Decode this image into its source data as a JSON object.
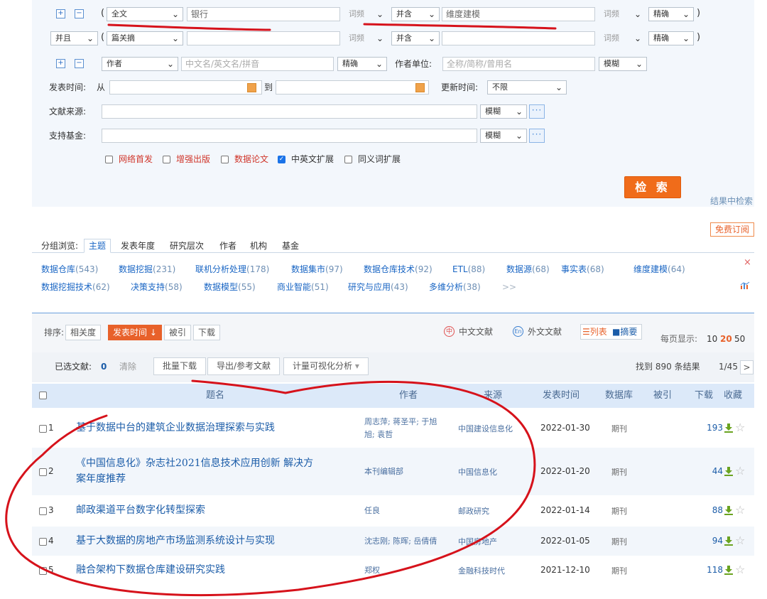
{
  "search": {
    "row1": {
      "plus": "+",
      "minus": "−",
      "open_paren": "(",
      "field": "全文",
      "value": "银行",
      "freq": "词频",
      "logic": "并含",
      "value2": "维度建模",
      "freq2": "词频",
      "match": "精确",
      "close_paren": ")"
    },
    "row2": {
      "op": "并且",
      "open_paren": "(",
      "field": "篇关摘",
      "value": "",
      "freq": "词频",
      "logic": "并含",
      "value2": "",
      "freq2": "词频",
      "match": "精确",
      "close_paren": ")"
    },
    "row3": {
      "plus": "+",
      "minus": "−",
      "field": "作者",
      "placeholder": "中文名/英文名/拼音",
      "match": "精确",
      "unit_label": "作者单位:",
      "unit_placeholder": "全称/简称/曾用名",
      "unit_match": "模糊"
    },
    "date": {
      "label": "发表时间:",
      "from": "从",
      "to": "到",
      "update_label": "更新时间:",
      "update_value": "不限"
    },
    "source": {
      "label": "文献来源:",
      "match": "模糊",
      "more": "···"
    },
    "fund": {
      "label": "支持基金:",
      "match": "模糊",
      "more": "···"
    },
    "options": [
      {
        "label": "网络首发",
        "checked": false,
        "red": true
      },
      {
        "label": "增强出版",
        "checked": false,
        "red": true
      },
      {
        "label": "数据论文",
        "checked": false,
        "red": true
      },
      {
        "label": "中英文扩展",
        "checked": true,
        "red": false
      },
      {
        "label": "同义词扩展",
        "checked": false,
        "red": false
      }
    ],
    "search_button": "检 索",
    "in_results": "结果中检索"
  },
  "subscribe": "免费订阅",
  "group": {
    "label": "分组浏览:",
    "tabs": [
      "主题",
      "发表年度",
      "研究层次",
      "作者",
      "机构",
      "基金"
    ],
    "active_tab": "主题",
    "keywords_row1": [
      {
        "name": "数据仓库",
        "count": "(543)"
      },
      {
        "name": "数据挖掘",
        "count": "(231)"
      },
      {
        "name": "联机分析处理",
        "count": "(178)"
      },
      {
        "name": "数据集市",
        "count": "(97)"
      },
      {
        "name": "数据仓库技术",
        "count": "(92)"
      },
      {
        "name": "ETL",
        "count": "(88)"
      },
      {
        "name": "数据源",
        "count": "(68)"
      },
      {
        "name": "事实表",
        "count": "(68)"
      },
      {
        "name": "维度建模",
        "count": "(64)"
      }
    ],
    "keywords_row2": [
      {
        "name": "数据挖掘技术",
        "count": "(62)"
      },
      {
        "name": "决策支持",
        "count": "(58)"
      },
      {
        "name": "数据模型",
        "count": "(55)"
      },
      {
        "name": "商业智能",
        "count": "(51)"
      },
      {
        "name": "研究与应用",
        "count": "(43)"
      },
      {
        "name": "多维分析",
        "count": "(38)"
      }
    ],
    "more": ">>",
    "close": "×"
  },
  "toolbar": {
    "sort_label": "排序:",
    "sort_options": [
      "相关度",
      "发表时间",
      "被引",
      "下载"
    ],
    "active_sort": "发表时间",
    "zh_docs": "中文文献",
    "foreign_docs": "外文文献",
    "view_list": "列表",
    "view_abstract": "摘要",
    "per_page_label": "每页显示:",
    "per_page": [
      "10",
      "20",
      "50"
    ],
    "active_per_page": "20",
    "selected_label": "已选文献:",
    "selected_count": "0",
    "clear": "清除",
    "batch_download": "批量下载",
    "export": "导出/参考文献",
    "visual_analysis": "计量可视化分析",
    "found_prefix": "找到",
    "found_count": "890",
    "found_suffix": "条结果",
    "page": "1/45",
    "next": ">"
  },
  "table": {
    "headers": [
      "题名",
      "作者",
      "来源",
      "发表时间",
      "数据库",
      "被引",
      "下载",
      "收藏"
    ],
    "rows": [
      {
        "no": "1",
        "title": "基于数据中台的建筑企业数据治理探索与实践",
        "title2": "",
        "author": "周志萍; 蒋圣平; 于旭",
        "author2": "旭; 袁哲",
        "source": "中国建设信息化",
        "date": "2022-01-30",
        "db": "期刊",
        "cited": "",
        "downloads": "193"
      },
      {
        "no": "2",
        "title": "《中国信息化》杂志社2021信息技术应用创新 解决方",
        "title2": "案年度推荐",
        "author": "本刊编辑部",
        "author2": "",
        "source": "中国信息化",
        "date": "2022-01-20",
        "db": "期刊",
        "cited": "",
        "downloads": "44"
      },
      {
        "no": "3",
        "title": "邮政渠道平台数字化转型探索",
        "title2": "",
        "author": "任良",
        "author2": "",
        "source": "邮政研究",
        "date": "2022-01-14",
        "db": "期刊",
        "cited": "",
        "downloads": "88"
      },
      {
        "no": "4",
        "title": "基于大数据的房地产市场监测系统设计与实现",
        "title2": "",
        "author": "沈志刚; 陈晖; 岳倩倩",
        "author2": "",
        "source": "中国房地产",
        "date": "2022-01-05",
        "db": "期刊",
        "cited": "",
        "downloads": "94"
      },
      {
        "no": "5",
        "title": "融合架构下数据仓库建设研究实践",
        "title2": "",
        "author": "郑权",
        "author2": "",
        "source": "金融科技时代",
        "date": "2021-12-10",
        "db": "期刊",
        "cited": "",
        "downloads": "118"
      }
    ]
  },
  "colors": {
    "accent": "#e8612a",
    "link": "#1b5ca8",
    "annotation": "#d6121b"
  }
}
